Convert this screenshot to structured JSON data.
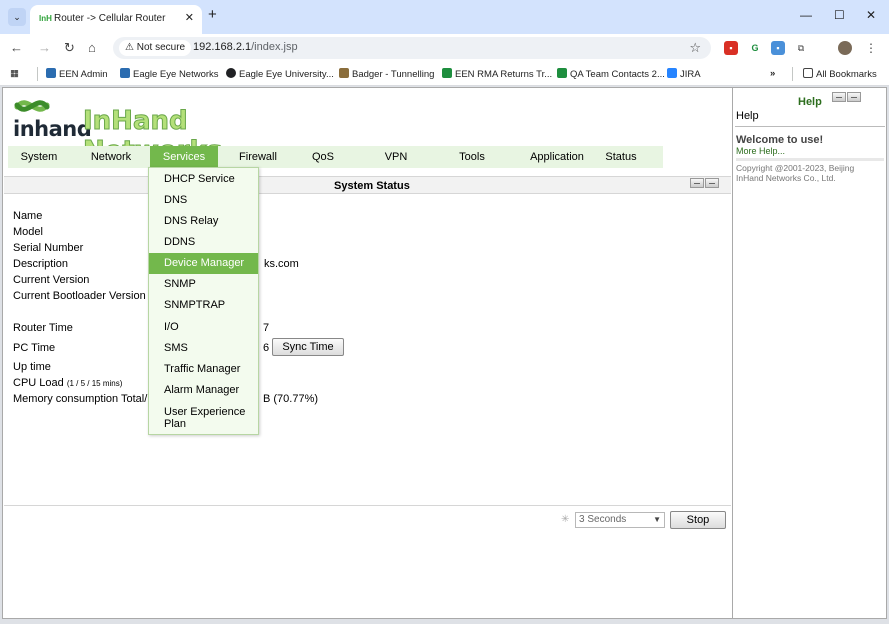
{
  "browser": {
    "tab_title": "Router -> Cellular Router",
    "tab_favicon": "InH",
    "security_label": "Not secure",
    "url_host": "192.168.2.1",
    "url_path": "/index.jsp",
    "bookmarks": [
      {
        "label": "EEN Admin",
        "color": "#2b6cb0"
      },
      {
        "label": "Eagle Eye Networks",
        "color": "#2b6cb0"
      },
      {
        "label": "Eagle Eye University...",
        "color": "#202124"
      },
      {
        "label": "Badger - Tunnelling",
        "color": "#8a6d3b"
      },
      {
        "label": "EEN RMA Returns Tr...",
        "color": "#1e8e3e"
      },
      {
        "label": "QA Team Contacts 2...",
        "color": "#1e8e3e"
      },
      {
        "label": "JIRA",
        "color": "#2684ff"
      }
    ],
    "all_bookmarks": "All Bookmarks"
  },
  "header": {
    "logo_word": "inhand",
    "brand": "InHand Networks"
  },
  "nav": [
    "System",
    "Network",
    "Services",
    "Firewall",
    "QoS",
    "VPN",
    "Tools",
    "Application",
    "Status"
  ],
  "active_nav": "Services",
  "status_panel": {
    "title": "System Status",
    "labels": {
      "name": "Name",
      "model": "Model",
      "serial": "Serial Number",
      "description": "Description",
      "version": "Current Version",
      "bootloader": "Current Bootloader Version",
      "router_time": "Router Time",
      "pc_time": "PC Time",
      "uptime": "Up time",
      "cpu_load": "CPU Load",
      "cpu_load_note": "(1 / 5 / 15 mins)",
      "memory": "Memory consumption Total/Fr"
    },
    "values": {
      "description_tail": "ks.com",
      "router_time_tail": "7",
      "pc_time_tail": "6",
      "memory_tail": "B (70.77%)"
    },
    "sync_button": "Sync Time",
    "refresh_option": "3 Seconds",
    "stop_button": "Stop"
  },
  "services_menu": [
    "DHCP Service",
    "DNS",
    "DNS Relay",
    "DDNS",
    "Device Manager",
    "SNMP",
    "SNMPTRAP",
    "I/O",
    "SMS",
    "Traffic Manager",
    "Alarm Manager",
    "User Experience Plan"
  ],
  "highlighted_menu_item": "Device Manager",
  "help": {
    "header": "Help",
    "label": "Help",
    "welcome": "Welcome to use!",
    "more": "More Help...",
    "copyright": "Copyright @2001-2023, Beijing InHand Networks Co., Ltd."
  },
  "colors": {
    "nav_bg": "#e8f5e2",
    "nav_active": "#73b84c",
    "brand_green": "#b4e07a",
    "help_green": "#2d6e1e"
  }
}
